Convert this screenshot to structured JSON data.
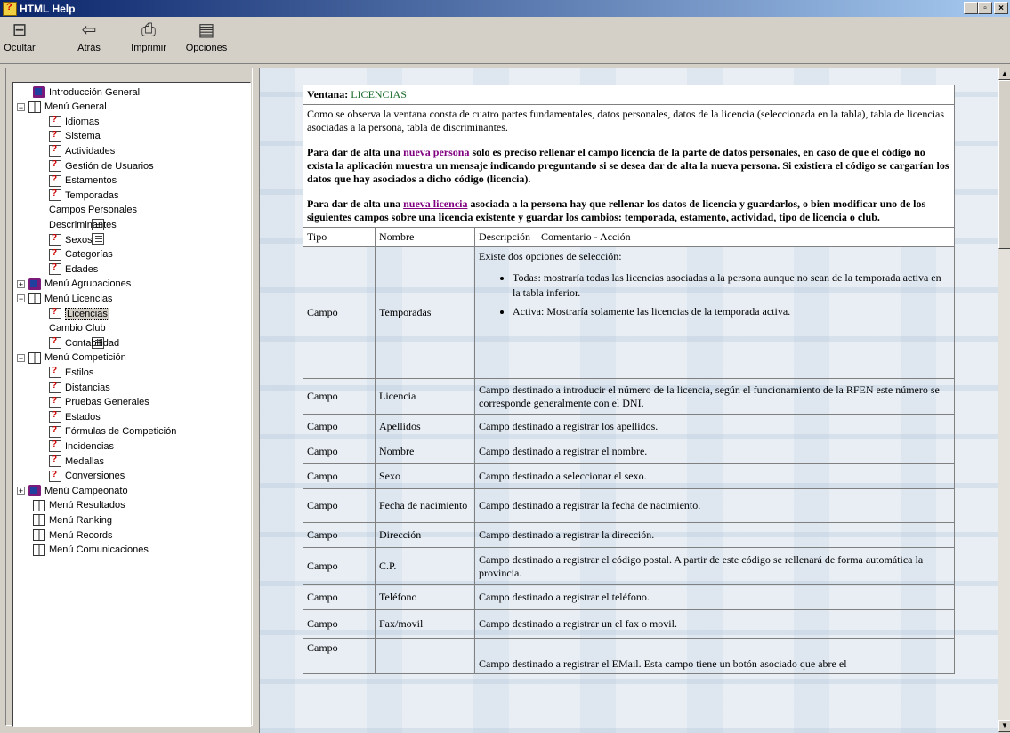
{
  "window": {
    "title": "HTML Help"
  },
  "window_buttons": {
    "minimize": "_",
    "restore": "▫",
    "close": "×"
  },
  "toolbar": [
    {
      "name": "hide-button",
      "icon": "hide-icon",
      "glyph": "⊟",
      "label": "Ocultar"
    },
    {
      "name": "back-button",
      "icon": "back-arrow-icon",
      "glyph": "⇦",
      "label": "Atrás"
    },
    {
      "name": "print-button",
      "icon": "printer-icon",
      "glyph": "⎙",
      "label": "Imprimir"
    },
    {
      "name": "options-button",
      "icon": "options-icon",
      "glyph": "▤",
      "label": "Opciones"
    }
  ],
  "tree": [
    {
      "label": "Introducción General",
      "icon": "book",
      "level": 1
    },
    {
      "label": "Menú General",
      "icon": "openbook",
      "level": 0,
      "exp": "−"
    },
    {
      "label": "Idiomas",
      "icon": "page",
      "level": 2
    },
    {
      "label": "Sistema",
      "icon": "page",
      "level": 2
    },
    {
      "label": "Actividades",
      "icon": "page",
      "level": 2
    },
    {
      "label": "Gestión de Usuarios",
      "icon": "page",
      "level": 2
    },
    {
      "label": "Estamentos",
      "icon": "page",
      "level": 2
    },
    {
      "label": "Temporadas",
      "icon": "page",
      "level": 2
    },
    {
      "label": "Campos Personales",
      "icon": "doc",
      "level": 2
    },
    {
      "label": "Descriminantes",
      "icon": "doc",
      "level": 2
    },
    {
      "label": "Sexos",
      "icon": "page",
      "level": 2
    },
    {
      "label": "Categorías",
      "icon": "page",
      "level": 2
    },
    {
      "label": "Edades",
      "icon": "page",
      "level": 2
    },
    {
      "label": "Menú Agrupaciones",
      "icon": "book",
      "level": 0,
      "exp": "+"
    },
    {
      "label": "Menú Licencias",
      "icon": "openbook",
      "level": 0,
      "exp": "−"
    },
    {
      "label": "Licencias",
      "icon": "page",
      "level": 2,
      "selected": true
    },
    {
      "label": "Cambio Club",
      "icon": "doc",
      "level": 2
    },
    {
      "label": "Contabilidad",
      "icon": "page",
      "level": 2
    },
    {
      "label": "Menú Competición",
      "icon": "openbook",
      "level": 0,
      "exp": "−"
    },
    {
      "label": "Estilos",
      "icon": "page",
      "level": 2
    },
    {
      "label": "Distancias",
      "icon": "page",
      "level": 2
    },
    {
      "label": "Pruebas Generales",
      "icon": "page",
      "level": 2
    },
    {
      "label": "Estados",
      "icon": "page",
      "level": 2
    },
    {
      "label": "Fórmulas de Competición",
      "icon": "page",
      "level": 2
    },
    {
      "label": "Incidencias",
      "icon": "page",
      "level": 2
    },
    {
      "label": "Medallas",
      "icon": "page",
      "level": 2
    },
    {
      "label": "Conversiones",
      "icon": "page",
      "level": 2
    },
    {
      "label": "Menú Campeonato",
      "icon": "book",
      "level": 0,
      "exp": "+"
    },
    {
      "label": "Menú Resultados",
      "icon": "openbook",
      "level": 1
    },
    {
      "label": "Menú Ranking",
      "icon": "openbook",
      "level": 1
    },
    {
      "label": "Menú Records",
      "icon": "openbook",
      "level": 1
    },
    {
      "label": "Menú Comunicaciones",
      "icon": "openbook",
      "level": 1
    }
  ],
  "doc": {
    "header_label": "Ventana:",
    "header_value": "LICENCIAS",
    "intro1": "Como se observa la ventana consta de cuatro partes fundamentales, datos personales, datos de la licencia (seleccionada en la tabla), tabla de licencias asociadas a la persona, tabla de discriminantes.",
    "intro2_a": "Para dar de alta una ",
    "intro2_link": "nueva persona",
    "intro2_b": " solo es preciso rellenar el campo licencia de la parte de datos personales, en caso de que el código no exista la aplicación muestra un mensaje indicando preguntando si se desea dar de alta la nueva persona. Si existiera el código se cargarían los datos que hay asociados a dicho código (licencia).",
    "intro3_a": "Para dar de alta una ",
    "intro3_link": "nueva licencia",
    "intro3_b": " asociada a la persona hay que rellenar los datos de licencia y guardarlos, o bien modificar uno de los siguientes campos sobre una licencia existente y guardar los cambios: temporada, estamento, actividad, tipo de licencia o club.",
    "columns": [
      "Tipo",
      "Nombre",
      "Descripción – Comentario - Acción"
    ],
    "temporadas_intro": "Existe dos opciones de selección:",
    "temporadas_opts": [
      "Todas: mostraría todas las licencias asociadas a la persona aunque no sean de la temporada activa en la tabla inferior.",
      "Activa: Mostraría solamente las licencias de la temporada activa."
    ],
    "rows": [
      {
        "tipo": "Campo",
        "nombre": "Temporadas",
        "desc": ""
      },
      {
        "tipo": "Campo",
        "nombre": "Licencia",
        "desc": "Campo destinado a introducir el número de la licencia, según el funcionamiento de la RFEN este número se corresponde generalmente con el DNI."
      },
      {
        "tipo": "Campo",
        "nombre": "Apellidos",
        "desc": "Campo destinado a registrar los apellidos."
      },
      {
        "tipo": "Campo",
        "nombre": "Nombre",
        "desc": "Campo destinado a registrar el nombre."
      },
      {
        "tipo": "Campo",
        "nombre": "Sexo",
        "desc": "Campo destinado a seleccionar el sexo."
      },
      {
        "tipo": "Campo",
        "nombre": "Fecha de nacimiento",
        "desc": "Campo destinado a registrar la fecha de nacimiento."
      },
      {
        "tipo": "Campo",
        "nombre": "Dirección",
        "desc": "Campo destinado a registrar la dirección."
      },
      {
        "tipo": "Campo",
        "nombre": "C.P.",
        "desc": "Campo destinado a registrar el código postal. A partir de este código se rellenará de forma automática la provincia."
      },
      {
        "tipo": "Campo",
        "nombre": "Teléfono",
        "desc": "Campo destinado a registrar el teléfono."
      },
      {
        "tipo": "Campo",
        "nombre": "Fax/movil",
        "desc": "Campo destinado a registrar un el fax o movil."
      },
      {
        "tipo": "Campo",
        "nombre": "",
        "desc": "Campo destinado a registrar el EMail. Esta campo tiene un botón asociado que abre el"
      }
    ]
  }
}
